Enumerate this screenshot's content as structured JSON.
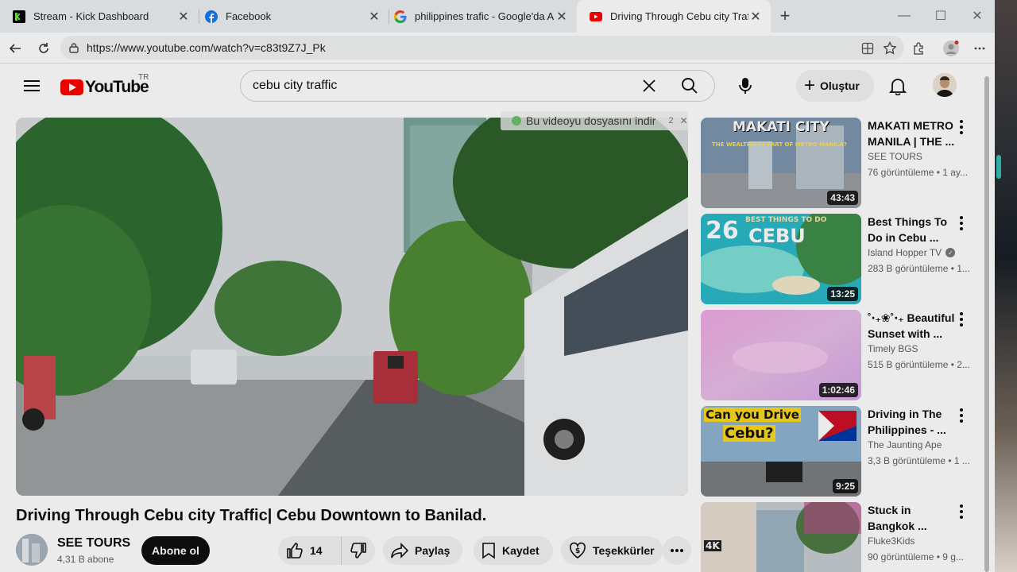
{
  "tabs": [
    {
      "title": "Stream - Kick Dashboard",
      "icon": "kick-icon"
    },
    {
      "title": "Facebook",
      "icon": "facebook-icon"
    },
    {
      "title": "philippines trafic - Google'da Ara",
      "icon": "google-icon"
    },
    {
      "title": "Driving Through Cebu city Traffic|",
      "icon": "youtube-icon"
    }
  ],
  "address": {
    "url": "https://www.youtube.com/watch?v=c83t9Z7J_Pk"
  },
  "youtube": {
    "logo_text": "YouTube",
    "country_code": "TR",
    "search_query": "cebu city traffic",
    "create_label": "Oluştur"
  },
  "video": {
    "download_hint": "Bu videoyu dosyasını indir",
    "download_hint_count": "2",
    "title": "Driving Through Cebu city Traffic| Cebu Downtown to Banilad.",
    "channel": "SEE TOURS",
    "subscribers": "4,31 B abone",
    "subscribe_label": "Abone ol",
    "likes": "14",
    "share_label": "Paylaş",
    "save_label": "Kaydet",
    "thanks_label": "Teşekkürler"
  },
  "recommendations": [
    {
      "title": "MAKATI METRO MANILA | THE ...",
      "channel": "SEE TOURS",
      "meta": "76 görüntüleme • 1 ay...",
      "duration": "43:43",
      "thumb_text": "MAKATI CITY",
      "thumb_sub": "THE WEALTHIEST PART OF METRO MANILA?",
      "verified": false
    },
    {
      "title": "Best Things To Do in Cebu ...",
      "channel": "Island Hopper TV",
      "meta": "283 B görüntüleme • 1...",
      "duration": "13:25",
      "thumb_text": "CEBU",
      "thumb_num": "26",
      "thumb_sub": "BEST THINGS TO DO",
      "verified": true
    },
    {
      "title": "˚‧₊❀˚‧₊ Beautiful Sunset with ...",
      "channel": "Timely BGS",
      "meta": "515 B görüntüleme • 2...",
      "duration": "1:02:46",
      "verified": false
    },
    {
      "title": "Driving in The Philippines - ...",
      "channel": "The Jaunting Ape",
      "meta": "3,3 B görüntüleme • 1 ...",
      "duration": "9:25",
      "thumb_text": "Can you Drive",
      "thumb_text2": "Cebu?",
      "verified": false
    },
    {
      "title": "Stuck in Bangkok ...",
      "channel": "Fluke3Kids",
      "meta": "90 görüntüleme • 9 g...",
      "duration": "",
      "thumb_text": "4K",
      "verified": false
    }
  ]
}
